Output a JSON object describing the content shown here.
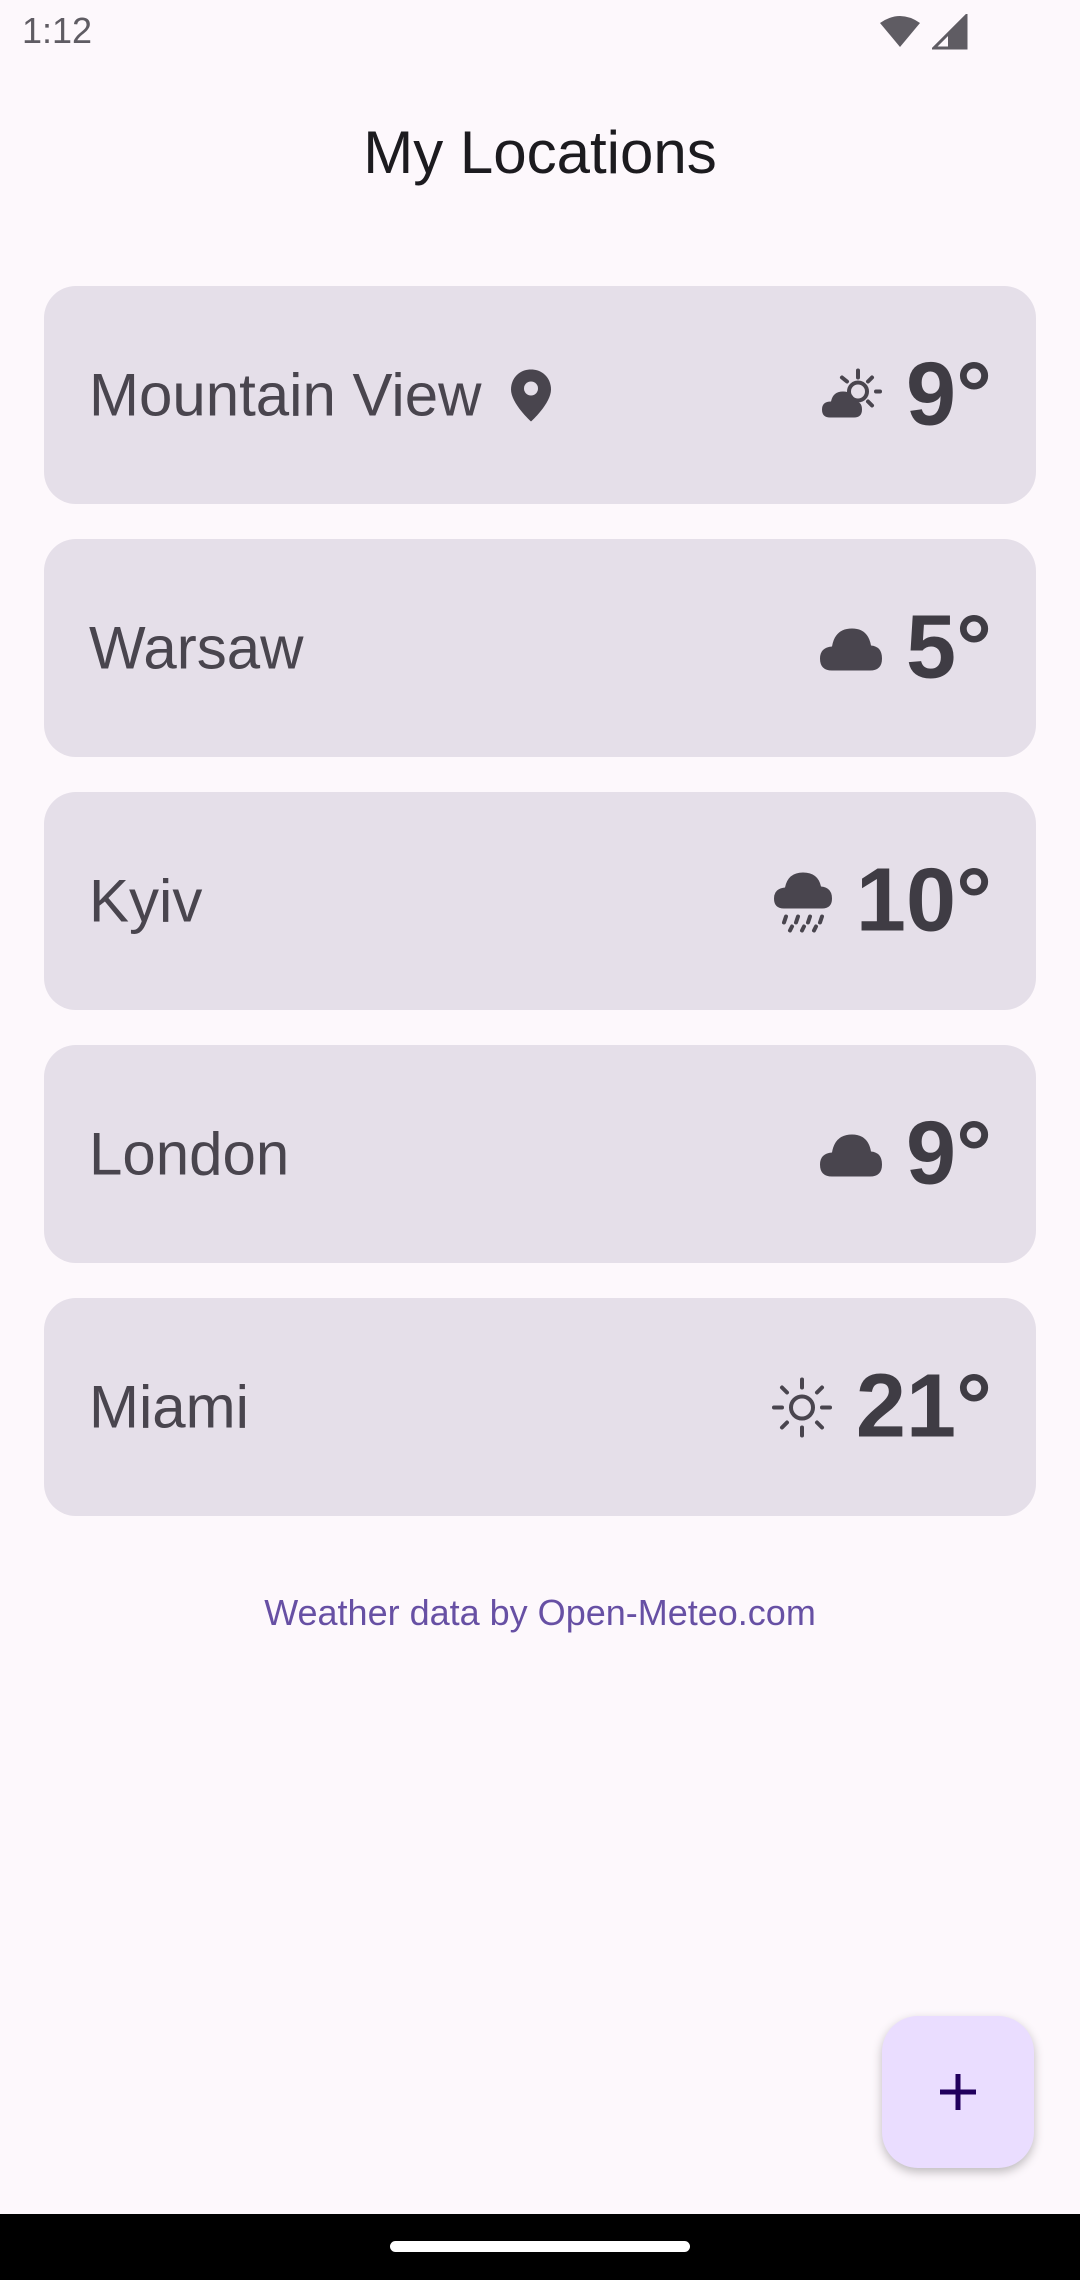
{
  "status_bar": {
    "time": "1:12"
  },
  "header": {
    "title": "My Locations"
  },
  "locations": [
    {
      "name": "Mountain View",
      "current": true,
      "condition_icon": "partly-cloudy-icon",
      "temperature": "9°"
    },
    {
      "name": "Warsaw",
      "current": false,
      "condition_icon": "cloud-icon",
      "temperature": "5°"
    },
    {
      "name": "Kyiv",
      "current": false,
      "condition_icon": "rain-icon",
      "temperature": "10°"
    },
    {
      "name": "London",
      "current": false,
      "condition_icon": "cloud-icon",
      "temperature": "9°"
    },
    {
      "name": "Miami",
      "current": false,
      "condition_icon": "sun-icon",
      "temperature": "21°"
    }
  ],
  "footer": {
    "attribution": "Weather data by Open-Meteo.com"
  },
  "fab": {
    "icon": "plus-icon"
  },
  "colors": {
    "background": "#fdf8fc",
    "card": "#e5dfe9",
    "text": "#49454e",
    "accent": "#6750a4",
    "fab": "#eaddff"
  }
}
